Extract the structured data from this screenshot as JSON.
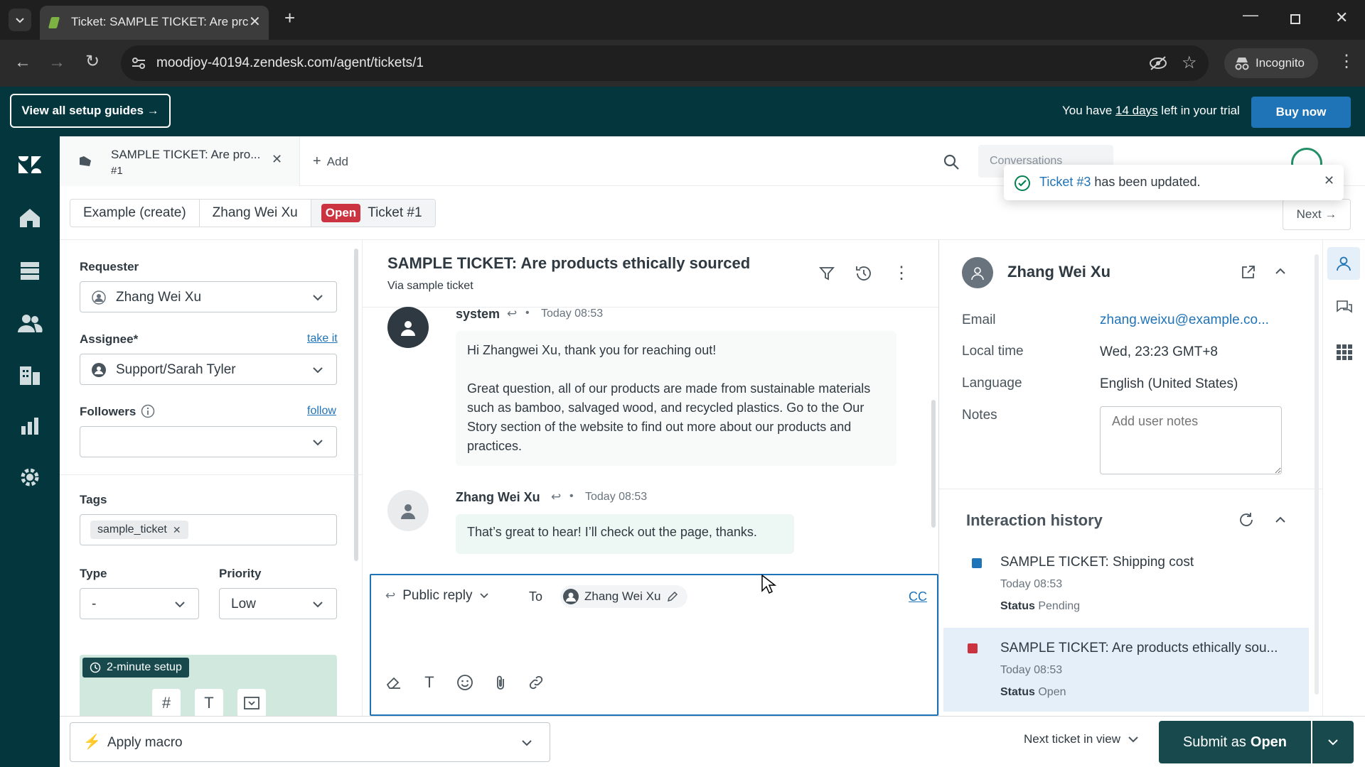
{
  "browser": {
    "tab_title": "Ticket: SAMPLE TICKET: Are prc",
    "url": "moodjoy-40194.zendesk.com/agent/tickets/1",
    "incognito_label": "Incognito"
  },
  "trial": {
    "guides_button": "View all setup guides →",
    "text_before": "You have",
    "days": "14 days",
    "text_after": "left in your trial",
    "buy_button": "Buy now"
  },
  "topbar": {
    "ticket_tab_title": "SAMPLE TICKET: Are pro...",
    "ticket_tab_number": "#1",
    "add_label": "Add",
    "search_hint": "Conversations"
  },
  "toast": {
    "ticket_link": "Ticket #3",
    "text": "has been updated."
  },
  "breadcrumb": {
    "org": "Example (create)",
    "requester": "Zhang Wei Xu",
    "status_badge": "Open",
    "ticket": "Ticket #1",
    "next_label": "Next →"
  },
  "props": {
    "requester_label": "Requester",
    "requester_value": "Zhang Wei Xu",
    "assignee_label": "Assignee*",
    "take_it": "take it",
    "assignee_value": "Support/Sarah Tyler",
    "followers_label": "Followers",
    "follow_link": "follow",
    "tags_label": "Tags",
    "tag": "sample_ticket",
    "type_label": "Type",
    "type_value": "-",
    "priority_label": "Priority",
    "priority_value": "Low",
    "setup_badge": "2-minute setup"
  },
  "conversation": {
    "title": "SAMPLE TICKET: Are products ethically sourced",
    "via": "Via sample ticket",
    "messages": [
      {
        "author": "system",
        "time": "Today 08:53",
        "paragraphs": [
          "Hi Zhangwei Xu, thank you for reaching out!",
          "Great question, all of our products are made from sustainable materials such as bamboo, salvaged wood, and recycled plastics. Go to the Our Story section of the website to find out more about our products and practices."
        ]
      },
      {
        "author": "Zhang Wei Xu",
        "time": "Today 08:53",
        "paragraphs": [
          "That’s great to hear! I’ll check out the page, thanks."
        ]
      }
    ],
    "separator": "•"
  },
  "composer": {
    "reply_mode": "Public reply",
    "to_label": "To",
    "recipient": "Zhang Wei Xu",
    "cc_label": "CC"
  },
  "context": {
    "user_name": "Zhang Wei Xu",
    "email_label": "Email",
    "email_value": "zhang.weixu@example.co...",
    "local_time_label": "Local time",
    "local_time_value": "Wed, 23:23 GMT+8",
    "language_label": "Language",
    "language_value": "English (United States)",
    "notes_label": "Notes",
    "notes_placeholder": "Add user notes",
    "history_title": "Interaction history",
    "history": [
      {
        "title": "SAMPLE TICKET: Shipping cost",
        "time": "Today 08:53",
        "status_label": "Status",
        "status": "Pending",
        "color": "#1f73b7"
      },
      {
        "title": "SAMPLE TICKET: Are products ethically sou...",
        "time": "Today 08:53",
        "status_label": "Status",
        "status": "Open",
        "color": "#cc3340"
      }
    ]
  },
  "footer": {
    "apply_macro": "Apply macro",
    "next_ticket": "Next ticket in view",
    "submit_prefix": "Submit as",
    "submit_status": "Open"
  },
  "colors": {
    "brand_dark": "#03363d",
    "accent_blue": "#1f73b7",
    "open_red": "#cc3340",
    "submit_bg": "#17494d"
  }
}
